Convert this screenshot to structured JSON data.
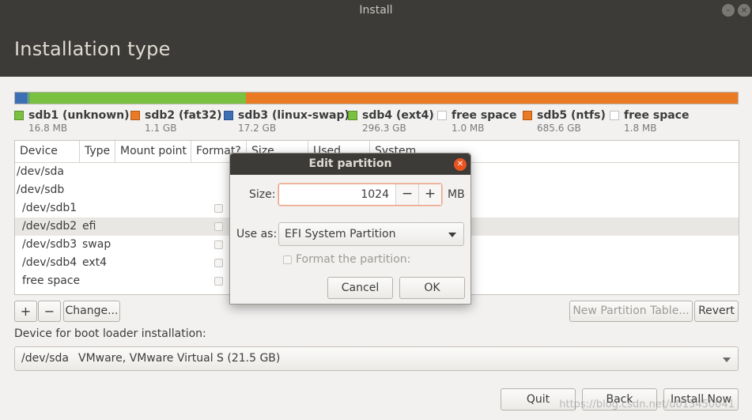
{
  "window": {
    "title": "Install"
  },
  "header": {
    "title": "Installation type"
  },
  "partition_bar": {
    "segments": [
      {
        "name": "sdb1",
        "color": "#3d6fb4",
        "fraction": 0.018
      },
      {
        "name": "sdb2",
        "color": "#8fd14f",
        "fraction": 0.001
      },
      {
        "name": "sdb3",
        "color": "#3d6fb4",
        "fraction": 0.001
      },
      {
        "name": "sdb4",
        "color": "#7ac142",
        "fraction": 0.3
      },
      {
        "name": "sdb5",
        "color": "#ea7a24",
        "fraction": 0.68
      }
    ]
  },
  "legend": [
    {
      "label": "sdb1 (unknown)",
      "size": "16.8 MB",
      "color": "#7ac142"
    },
    {
      "label": "sdb2 (fat32)",
      "size": "1.1 GB",
      "color": "#ea7a24"
    },
    {
      "label": "sdb3 (linux-swap)",
      "size": "17.2 GB",
      "color": "#3d6fb4"
    },
    {
      "label": "sdb4 (ext4)",
      "size": "296.3 GB",
      "color": "#7ac142"
    },
    {
      "label": "free space",
      "size": "1.0 MB",
      "color": "#ffffff"
    },
    {
      "label": "sdb5 (ntfs)",
      "size": "685.6 GB",
      "color": "#ea7a24"
    },
    {
      "label": "free space",
      "size": "1.8 MB",
      "color": "#ffffff"
    }
  ],
  "table": {
    "columns": [
      "Device",
      "Type",
      "Mount point",
      "Format?",
      "Size",
      "Used",
      "System"
    ],
    "rows": [
      {
        "device": "/dev/sda",
        "type": ""
      },
      {
        "device": "/dev/sdb",
        "type": ""
      },
      {
        "device": "/dev/sdb1",
        "type": ""
      },
      {
        "device": "/dev/sdb2",
        "type": "efi"
      },
      {
        "device": "/dev/sdb3",
        "type": "swap"
      },
      {
        "device": "/dev/sdb4",
        "type": "ext4"
      },
      {
        "device": "free space",
        "type": ""
      }
    ]
  },
  "toolbar": {
    "add_label": "+",
    "remove_label": "−",
    "change_label": "Change...",
    "new_table_label": "New Partition Table...",
    "revert_label": "Revert"
  },
  "bootloader": {
    "label": "Device for boot loader installation:",
    "device": "/dev/sda",
    "description": "VMware, VMware Virtual S (21.5 GB)"
  },
  "footer": {
    "quit_label": "Quit",
    "back_label": "Back",
    "install_label": "Install Now"
  },
  "dialog": {
    "title": "Edit partition",
    "size_label": "Size:",
    "size_value": "1024",
    "size_unit": "MB",
    "minus_label": "−",
    "plus_label": "+",
    "use_as_label": "Use as:",
    "use_as_value": "EFI System Partition",
    "format_label": "Format the partition:",
    "cancel_label": "Cancel",
    "ok_label": "OK"
  },
  "watermark": "https://blog.csdn.net/u013450041"
}
